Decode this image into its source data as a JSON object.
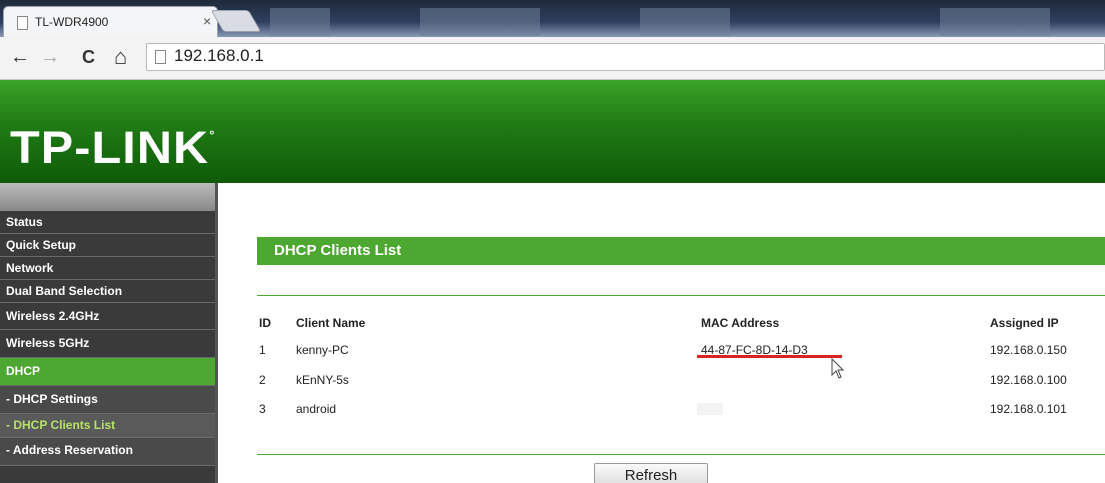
{
  "browser": {
    "tab_title": "TL-WDR4900",
    "tab_close": "×",
    "url": "192.168.0.1",
    "nav": {
      "back": "←",
      "forward": "→",
      "reload": "C",
      "home": "⌂"
    }
  },
  "router": {
    "logo": "TP-LINK",
    "logo_mark": "°"
  },
  "sidebar": {
    "items": [
      {
        "label": "Status"
      },
      {
        "label": "Quick Setup"
      },
      {
        "label": "Network"
      },
      {
        "label": "Dual Band Selection"
      },
      {
        "label": "Wireless 2.4GHz"
      },
      {
        "label": "Wireless 5GHz"
      },
      {
        "label": "DHCP"
      },
      {
        "label": "- DHCP Settings"
      },
      {
        "label": "- DHCP Clients List"
      },
      {
        "label": "- Address Reservation"
      }
    ]
  },
  "main": {
    "title": "DHCP Clients List",
    "table": {
      "headers": [
        "ID",
        "Client Name",
        "MAC Address",
        "Assigned IP"
      ],
      "rows": [
        [
          "1",
          "kenny-PC",
          "44-87-FC-8D-14-D3",
          "192.168.0.150"
        ],
        [
          "2",
          "kEnNY-5s",
          "",
          "192.168.0.100"
        ],
        [
          "3",
          "android",
          "",
          "192.168.0.101"
        ]
      ]
    },
    "refresh_label": "Refresh"
  },
  "colors": {
    "accent": "#4ca830",
    "header_dark": "#0f5b08",
    "sidebar_bg": "#3a3a3a",
    "highlight_underline": "#dd2222"
  }
}
